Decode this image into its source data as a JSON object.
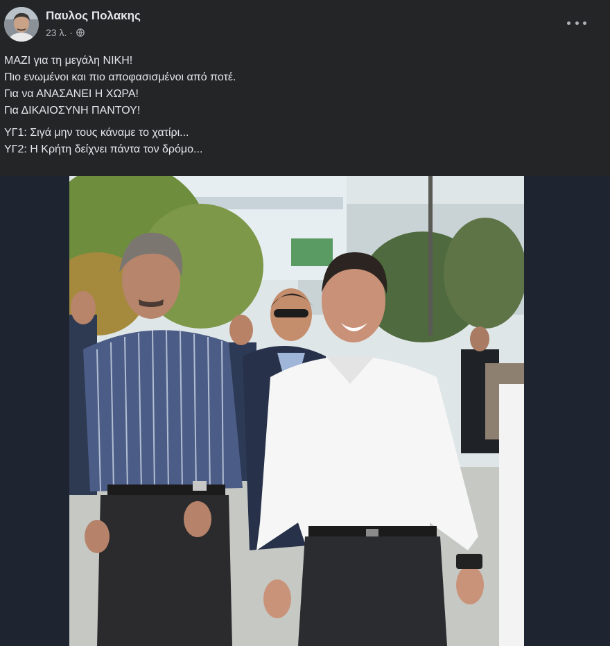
{
  "post": {
    "author": "Παυλος Πολακης",
    "timestamp": "23 λ. ·",
    "privacy_icon": "globe-icon",
    "more_icon": "more-horizontal-icon",
    "text_lines": [
      "ΜΑΖΙ για τη μεγάλη ΝΙΚΗ!",
      "Πιο ενωμένοι και πιο αποφασισμένοι από ποτέ.",
      "Για να ΑΝΑΣΑΝΕΙ Η ΧΩΡΑ!",
      "Για ΔΙΚΑΙΟΣΥΝΗ ΠΑΝΤΟΥ!"
    ],
    "ps_lines": [
      "ΥΓ1: Σιγά μην τους κάναμε το χατίρι...",
      "ΥΓ2: Η Κρήτη δείχνει πάντα τον δρόμο..."
    ]
  },
  "colors": {
    "background": "#242526",
    "text_primary": "#e4e6eb",
    "text_secondary": "#b0b3b8",
    "photo_backdrop": "#1e2430"
  }
}
